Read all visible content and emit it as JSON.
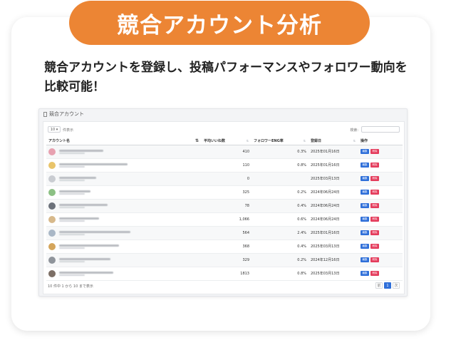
{
  "banner": {
    "title": "競合アカウント分析"
  },
  "description": "競合アカウントを登録し、投稿パフォーマンスやフォロワー動向を比較可能！",
  "screen": {
    "window_title": "競合アカウント",
    "length_select": "10 ▾",
    "length_text": "件表示",
    "search_label": "検索:",
    "columns": {
      "account": "アカウント名",
      "avg_likes": "平均いいね数",
      "follower_eng": "フォロワーENG率",
      "registered": "登録日",
      "actions": "操作"
    },
    "sorted_glyph": "⇅",
    "unsorted_glyph": "⇅",
    "edit_label": "編集",
    "delete_label": "削除",
    "rows": [
      {
        "likes": "410",
        "eng": "0.3%",
        "date": "2025年01月16日",
        "avatar_color": "#e7a1b0",
        "name_w": 62
      },
      {
        "likes": "110",
        "eng": "0.8%",
        "date": "2025年01月16日",
        "avatar_color": "#e9c46a",
        "name_w": 96
      },
      {
        "likes": "0",
        "eng": "",
        "date": "2025年03月13日",
        "avatar_color": "#c9ccd1",
        "name_w": 52
      },
      {
        "likes": "325",
        "eng": "0.2%",
        "date": "2024年06月24日",
        "avatar_color": "#8cc084",
        "name_w": 44
      },
      {
        "likes": "78",
        "eng": "0.4%",
        "date": "2024年06月24日",
        "avatar_color": "#6c717a",
        "name_w": 68
      },
      {
        "likes": "1,066",
        "eng": "0.6%",
        "date": "2024年06月24日",
        "avatar_color": "#d7b98b",
        "name_w": 56
      },
      {
        "likes": "564",
        "eng": "2.4%",
        "date": "2025年01月16日",
        "avatar_color": "#a9b7c6",
        "name_w": 100
      },
      {
        "likes": "368",
        "eng": "0.4%",
        "date": "2025年03月13日",
        "avatar_color": "#d4a55b",
        "name_w": 84
      },
      {
        "likes": "329",
        "eng": "0.2%",
        "date": "2024年12月16日",
        "avatar_color": "#8f949b",
        "name_w": 72
      },
      {
        "likes": "1813",
        "eng": "0.8%",
        "date": "2025年03月13日",
        "avatar_color": "#7d6f66",
        "name_w": 76
      }
    ],
    "footer_info": "10 件中 1 から 10 まで表示",
    "pagination": {
      "prev": "前",
      "current": "1",
      "next": "次"
    }
  }
}
